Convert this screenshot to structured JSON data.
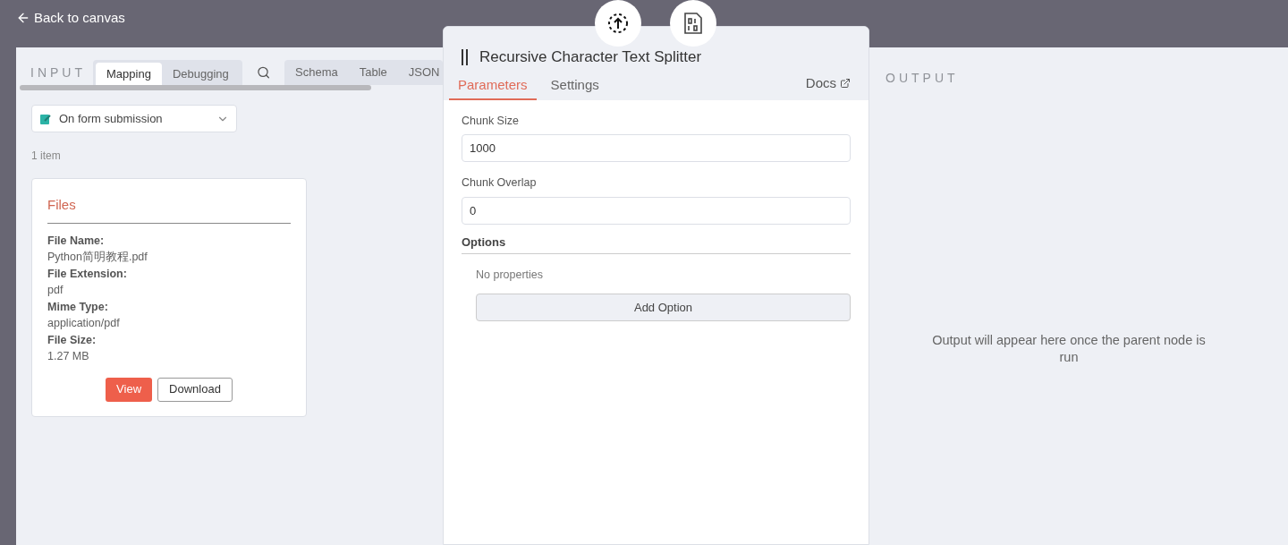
{
  "header": {
    "back_link": "Back to canvas"
  },
  "input": {
    "title": "INPUT",
    "mode_tabs": [
      {
        "label": "Mapping",
        "selected": true
      },
      {
        "label": "Debugging",
        "selected": false
      }
    ],
    "view_tabs": [
      {
        "label": "Schema",
        "selected": false
      },
      {
        "label": "Table",
        "selected": false
      },
      {
        "label": "JSON",
        "selected": false
      }
    ],
    "source_select": {
      "value": "On form submission"
    },
    "item_count": "1 item",
    "file_card": {
      "title": "Files",
      "fields": [
        {
          "label": "File Name:",
          "value": "Python简明教程.pdf"
        },
        {
          "label": "File Extension:",
          "value": "pdf"
        },
        {
          "label": "Mime Type:",
          "value": "application/pdf"
        },
        {
          "label": "File Size:",
          "value": "1.27 MB"
        }
      ],
      "buttons": [
        {
          "label": "View",
          "kind": "primary"
        },
        {
          "label": "Download",
          "kind": "secondary"
        }
      ]
    }
  },
  "node": {
    "title": "Recursive Character Text Splitter",
    "tabs": [
      {
        "label": "Parameters",
        "selected": true
      },
      {
        "label": "Settings",
        "selected": false
      }
    ],
    "docs_link": "Docs",
    "parameters": [
      {
        "label": "Chunk Size",
        "value": "1000"
      },
      {
        "label": "Chunk Overlap",
        "value": "0"
      }
    ],
    "options": {
      "title": "Options",
      "empty_text": "No properties",
      "add_button": "Add Option"
    }
  },
  "output": {
    "title": "OUTPUT",
    "message": "Output will appear here once the parent node is run"
  }
}
